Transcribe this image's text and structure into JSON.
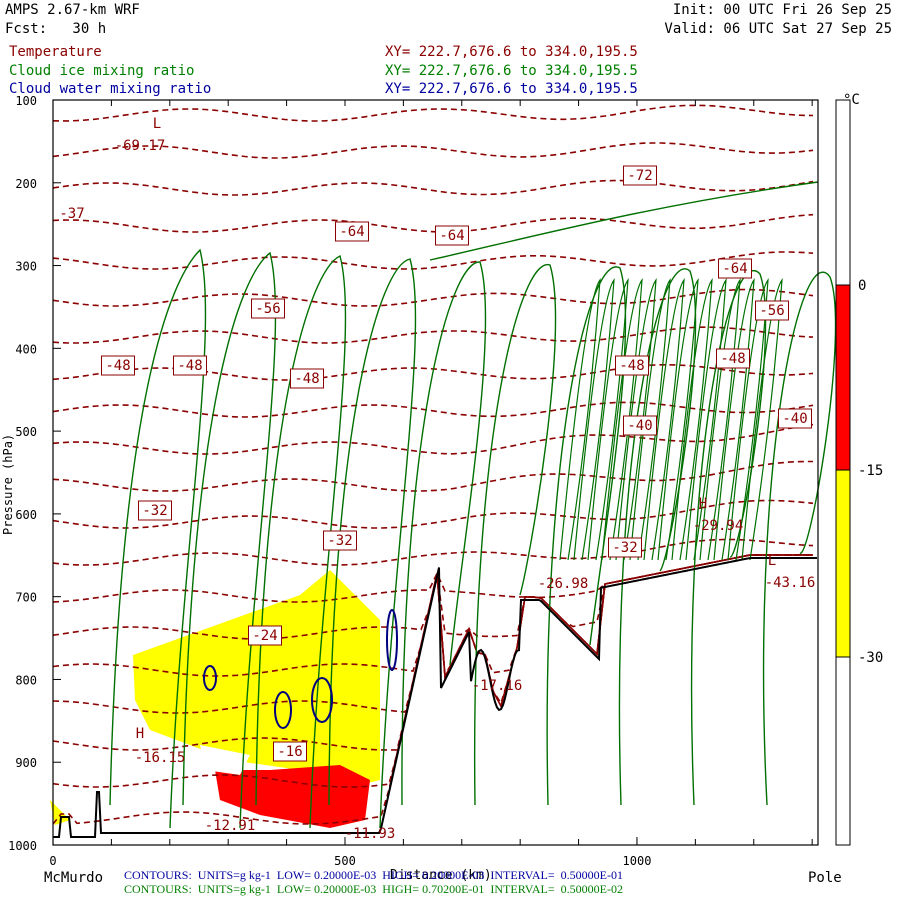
{
  "header": {
    "model": "AMPS 2.67-km WRF",
    "fcst": "Fcst:   30 h",
    "init": "Init: 00 UTC Fri 26 Sep 25",
    "valid": "Valid: 06 UTC Sat 27 Sep 25"
  },
  "fields": [
    {
      "name": "Temperature",
      "xy": "XY= 222.7,676.6 to 334.0,195.5",
      "color": "#8b0000"
    },
    {
      "name": "Cloud ice mixing ratio",
      "xy": "XY= 222.7,676.6 to 334.0,195.5",
      "color": "#008000"
    },
    {
      "name": "Cloud water mixing ratio",
      "xy": "XY= 222.7,676.6 to 334.0,195.5",
      "color": "#0000a0"
    }
  ],
  "footer": {
    "left": "McMurdo",
    "right": "Pole",
    "water_contours": "CONTOURS:  UNITS=g kg-1  LOW= 0.20000E-03  HIGH= 0.20000E-03  INTERVAL=  0.50000E-01",
    "ice_contours": "CONTOURS:  UNITS=g kg-1  LOW= 0.20000E-03  HIGH= 0.70200E-01  INTERVAL=  0.50000E-02"
  },
  "chart_data": {
    "type": "contour",
    "xlabel": "Distance (km)",
    "ylabel": "Pressure (hPa)",
    "xlim": [
      0,
      1310
    ],
    "ylim": [
      1000,
      100
    ],
    "xticks": [
      "0",
      "500",
      "1000"
    ],
    "yticks": [
      "100",
      "200",
      "300",
      "400",
      "500",
      "600",
      "700",
      "800",
      "900",
      "1000"
    ],
    "colorbar": {
      "unit": "°C",
      "labels": [
        "0",
        "-15",
        "-30"
      ],
      "bands": [
        {
          "from": 0,
          "to": -15,
          "color": "#ff0000"
        },
        {
          "from": -15,
          "to": -30,
          "color": "#ffff00"
        }
      ]
    },
    "temperature_labels": [
      "-69.17",
      "-72",
      "-64",
      "-64",
      "-64",
      "-56",
      "-56",
      "-48",
      "-48",
      "-48",
      "-48",
      "-48",
      "-40",
      "-40",
      "-32",
      "-32",
      "-32",
      "-24",
      "-16",
      "-16.15",
      "-12.91",
      "-11.93",
      "-17.16",
      "-26.98",
      "-29.94",
      "-43.16",
      "-37"
    ],
    "extrema": [
      {
        "type": "L",
        "value": "-69.17"
      },
      {
        "type": "H",
        "value": "-29.94"
      },
      {
        "type": "L",
        "value": "-43.16"
      },
      {
        "type": "H",
        "value": "-16.15"
      }
    ]
  }
}
